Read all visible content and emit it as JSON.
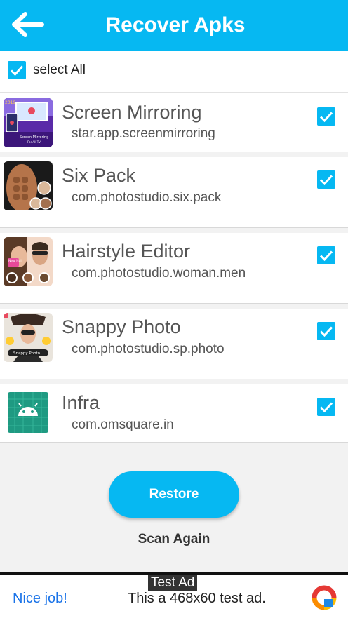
{
  "appbar": {
    "title": "Recover Apks"
  },
  "select_all": {
    "label": "select All",
    "checked": true
  },
  "apps": [
    {
      "name": "Screen Mirroring",
      "package": "star.app.screenmirroring",
      "checked": true,
      "icon": "screen-mirroring-app-icon"
    },
    {
      "name": "Six Pack",
      "package": "com.photostudio.six.pack",
      "checked": true,
      "icon": "six-pack-app-icon"
    },
    {
      "name": "Hairstyle Editor",
      "package": "com.photostudio.woman.men",
      "checked": true,
      "icon": "hairstyle-editor-app-icon"
    },
    {
      "name": "Snappy Photo",
      "package": "com.photostudio.sp.photo",
      "checked": true,
      "icon": "snappy-photo-app-icon"
    },
    {
      "name": "Infra",
      "package": "com.omsquare.in",
      "checked": true,
      "icon": "android-app-icon"
    }
  ],
  "icon_text": {
    "mirroring_year": "2019",
    "mirroring_caption": "Screen Mirroring",
    "mirroring_sub": "For All TV",
    "hairstyle_badge": "New Hair",
    "snappy_caption": "Snappy Photo"
  },
  "actions": {
    "restore_label": "Restore",
    "scan_again_label": "Scan Again"
  },
  "ad": {
    "tag": "Test Ad",
    "headline": "Nice job!",
    "text": "This a 468x60 test ad."
  },
  "colors": {
    "accent": "#06b8f2",
    "background": "#f2f2f2",
    "ad_link": "#1a73e8"
  }
}
